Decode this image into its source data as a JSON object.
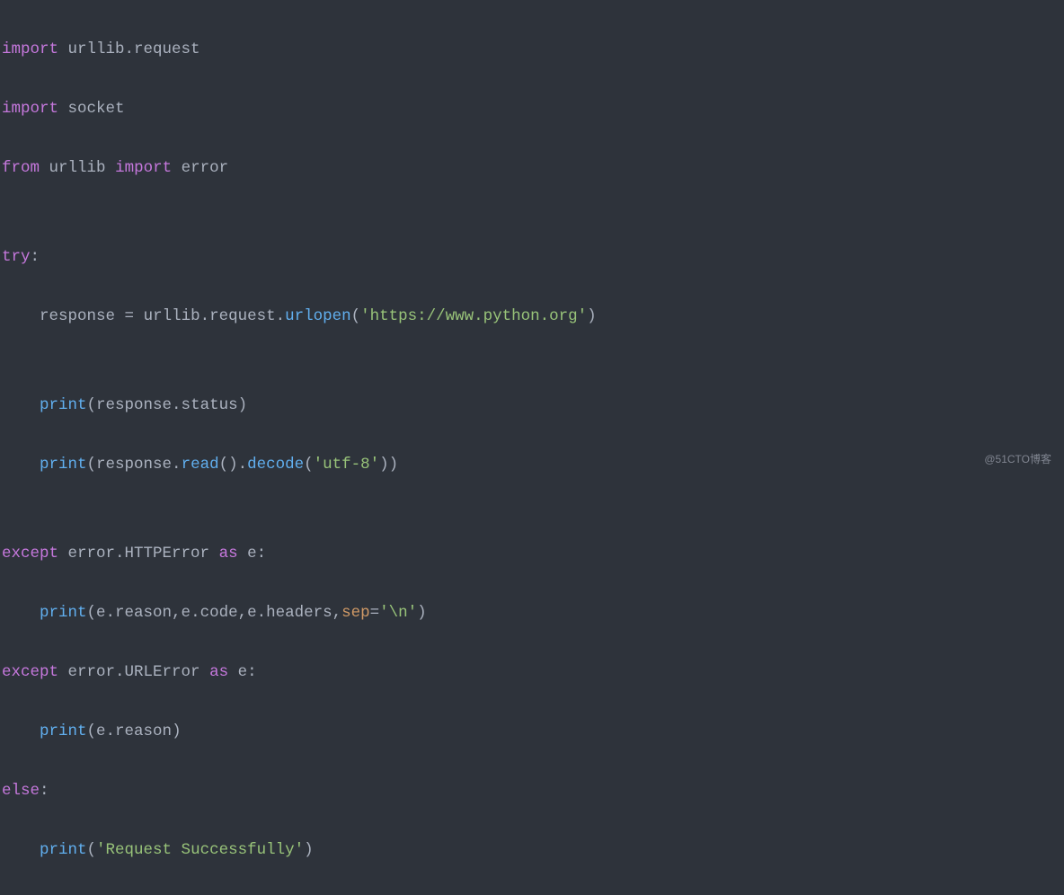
{
  "code": {
    "l1": {
      "kw1": "import",
      "sp1": " ",
      "id1": "urllib.request"
    },
    "l2": {
      "kw1": "import",
      "sp1": " ",
      "id1": "socket"
    },
    "l3": {
      "kw1": "from",
      "sp1": " ",
      "id1": "urllib",
      "sp2": " ",
      "kw2": "import",
      "sp3": " ",
      "id2": "error"
    },
    "l4": {
      "txt": ""
    },
    "l5": {
      "kw1": "try",
      "punc1": ":"
    },
    "l6": {
      "ind": "    ",
      "id1": "response ",
      "punc1": "=",
      "sp1": " ",
      "id2": "urllib.request.",
      "fn1": "urlopen",
      "punc2": "(",
      "str1": "'https://www.python.org'",
      "punc3": ")"
    },
    "l7": {
      "txt": ""
    },
    "l8": {
      "ind": "    ",
      "fn1": "print",
      "punc1": "(",
      "id1": "response.status",
      "punc2": ")"
    },
    "l9": {
      "ind": "    ",
      "fn1": "print",
      "punc1": "(",
      "id1": "response.",
      "fn2": "read",
      "punc2": "().",
      "fn3": "decode",
      "punc3": "(",
      "str1": "'utf-8'",
      "punc4": "))"
    },
    "l10": {
      "txt": ""
    },
    "l11": {
      "kw1": "except",
      "sp1": " ",
      "id1": "error.HTTPError",
      "sp2": " ",
      "kw2": "as",
      "sp3": " ",
      "id2": "e",
      "punc1": ":"
    },
    "l12": {
      "ind": "    ",
      "fn1": "print",
      "punc1": "(",
      "id1": "e.reason,e.code,e.headers,",
      "param1": "sep",
      "punc2": "=",
      "str1": "'\\n'",
      "punc3": ")"
    },
    "l13": {
      "kw1": "except",
      "sp1": " ",
      "id1": "error.URLError",
      "sp2": " ",
      "kw2": "as",
      "sp3": " ",
      "id2": "e",
      "punc1": ":"
    },
    "l14": {
      "ind": "    ",
      "fn1": "print",
      "punc1": "(",
      "id1": "e.reason",
      "punc2": ")"
    },
    "l15": {
      "kw1": "else",
      "punc1": ":"
    },
    "l16": {
      "ind": "    ",
      "fn1": "print",
      "punc1": "(",
      "str1": "'Request Successfully'",
      "punc2": ")"
    }
  },
  "watermark": "@51CTO博客"
}
